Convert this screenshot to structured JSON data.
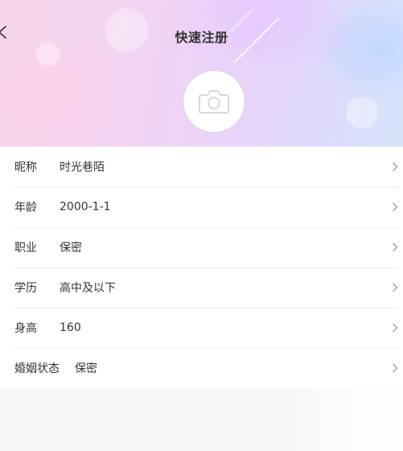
{
  "header": {
    "title": "快速注册",
    "back_icon": "chevron-left-icon"
  },
  "avatar": {
    "icon": "camera-icon"
  },
  "form": {
    "rows": [
      {
        "label": "昵称",
        "value": "时光巷陌"
      },
      {
        "label": "年龄",
        "value": "2000-1-1"
      },
      {
        "label": "职业",
        "value": "保密"
      },
      {
        "label": "学历",
        "value": "高中及以下"
      },
      {
        "label": "身高",
        "value": "160"
      },
      {
        "label": "婚姻状态",
        "value": "保密"
      }
    ]
  },
  "colors": {
    "hero_pink": "#f7d4ea",
    "hero_lavender": "#e9d4fa",
    "hero_blue": "#d5e4fb",
    "background": "#f5f5f5",
    "text": "#333333"
  }
}
